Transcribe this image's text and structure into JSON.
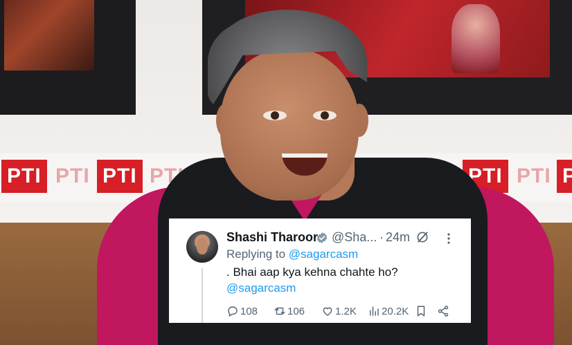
{
  "photo": {
    "banner_text": [
      "PTI",
      "PTI",
      "PTI",
      "PTI",
      "PTI",
      "PTI",
      "PTI"
    ]
  },
  "tweet": {
    "name": "Shashi Tharoor",
    "handle": "@Sha...",
    "separator": "·",
    "time": "24m",
    "replying_prefix": "Replying to ",
    "replying_to": "@sagarcasm",
    "text": ". Bhai aap kya kehna chahte ho?",
    "mention": "@sagarcasm",
    "stats": {
      "replies": "108",
      "retweets": "106",
      "likes": "1.2K",
      "views": "20.2K"
    },
    "icons": [
      "verified-badge-icon",
      "grok-icon",
      "more-icon",
      "reply-icon",
      "retweet-icon",
      "like-icon",
      "views-icon",
      "bookmark-icon",
      "share-icon"
    ],
    "colors": {
      "link": "#1d9bf0",
      "muted": "#536471",
      "text": "#0f1419",
      "verified": "#829aab"
    }
  }
}
